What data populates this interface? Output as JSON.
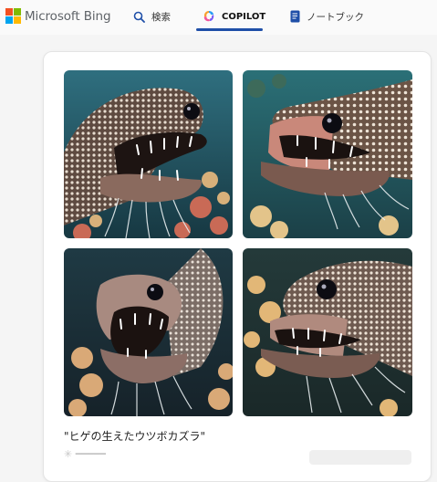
{
  "brand": {
    "name": "Microsoft Bing",
    "logo_colors": [
      "#f25022",
      "#7fba00",
      "#00a4ef",
      "#ffb900"
    ]
  },
  "nav": {
    "tabs": [
      {
        "label": "検索",
        "icon": "search-icon"
      },
      {
        "label": "COPILOT",
        "icon": "copilot-icon",
        "active": true
      },
      {
        "label": "ノートブック",
        "icon": "notebook-icon"
      }
    ],
    "accent_color": "#1f4fa8"
  },
  "result": {
    "images": [
      {
        "subject": "moray eel with whisker-like barbels, open mouth, coral reef"
      },
      {
        "subject": "moray eel with whisker-like barbels, open mouth, coral reef"
      },
      {
        "subject": "moray eel with whisker-like barbels, open mouth, coral reef"
      },
      {
        "subject": "moray eel with whisker-like barbels, open mouth, coral reef"
      }
    ],
    "prompt_caption": "\"ヒゲの生えたウツボカズラ\""
  }
}
